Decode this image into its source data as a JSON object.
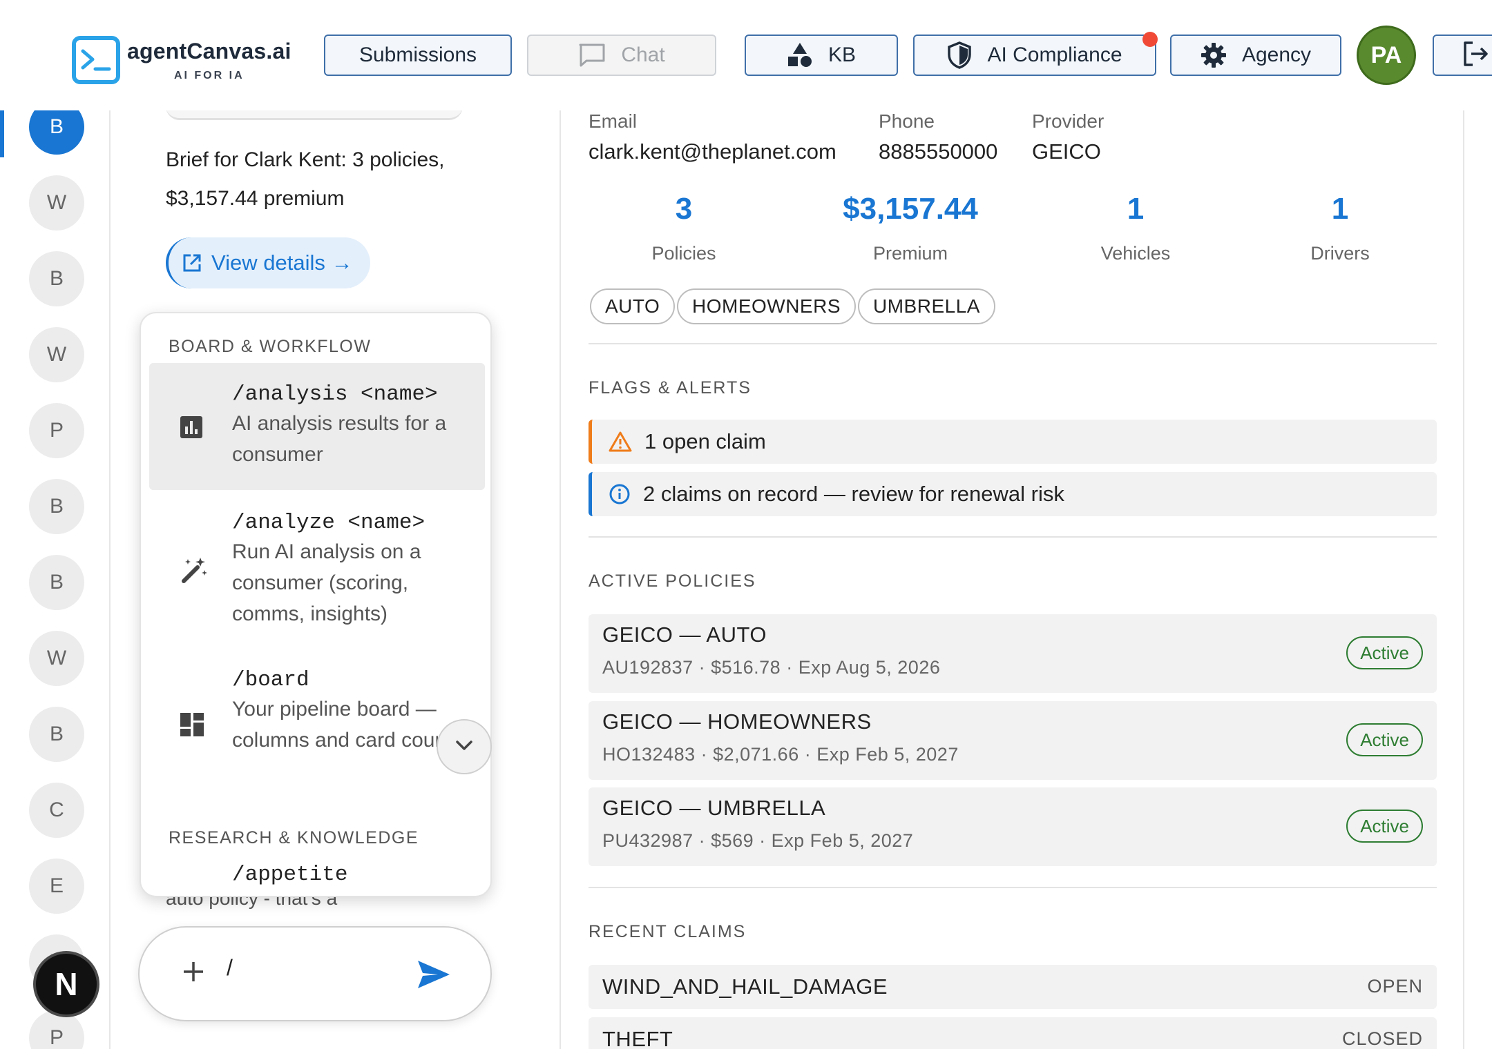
{
  "header": {
    "logo_title": "agentCanvas.ai",
    "logo_sub": "AI FOR IA",
    "nav": {
      "submissions": "Submissions",
      "chat": "Chat",
      "kb": "KB",
      "ai_compliance": "AI Compliance",
      "agency": "Agency"
    },
    "avatar_initials": "PA",
    "colors": {
      "accent": "#1976d2",
      "notification": "#f04a37",
      "avatar": "#5a8a2e"
    }
  },
  "rail": {
    "items": [
      "B",
      "W",
      "B",
      "W",
      "P",
      "B",
      "B",
      "W",
      "B",
      "C",
      "E",
      "B",
      "P"
    ],
    "active_index": 0,
    "next_badge": "N"
  },
  "chat": {
    "brief": "Brief for Clark Kent: 3 policies, $3,157.44 premium",
    "view_details": "View details →",
    "behind_text": "auto policy - that's a",
    "input_value": "/",
    "commands": {
      "section_board": "BOARD & WORKFLOW",
      "section_research": "RESEARCH & KNOWLEDGE",
      "items": [
        {
          "name": "/analysis <name>",
          "desc": "AI analysis results for a consumer",
          "icon": "bar-chart-icon"
        },
        {
          "name": "/analyze <name>",
          "desc": "Run AI analysis on a consumer (scoring, comms, insights)",
          "icon": "magic-wand-icon"
        },
        {
          "name": "/board",
          "desc": "Your pipeline board — columns and card counts",
          "icon": "dashboard-icon"
        },
        {
          "name": "/appetite",
          "desc": "",
          "icon": ""
        }
      ]
    }
  },
  "detail": {
    "email_label": "Email",
    "email": "clark.kent@theplanet.com",
    "phone_label": "Phone",
    "phone": "8885550000",
    "provider_label": "Provider",
    "provider": "GEICO",
    "stats": [
      {
        "value": "3",
        "label": "Policies"
      },
      {
        "value": "$3,157.44",
        "label": "Premium"
      },
      {
        "value": "1",
        "label": "Vehicles"
      },
      {
        "value": "1",
        "label": "Drivers"
      }
    ],
    "chips": [
      "AUTO",
      "HOMEOWNERS",
      "UMBRELLA"
    ],
    "flags_title": "FLAGS & ALERTS",
    "alerts": [
      {
        "text": "1 open claim",
        "level": "warning"
      },
      {
        "text": "2 claims on record — review for renewal risk",
        "level": "info"
      }
    ],
    "policies_title": "ACTIVE POLICIES",
    "policies": [
      {
        "title": "GEICO — AUTO",
        "meta": "AU192837 · $516.78 · Exp Aug 5, 2026",
        "status": "Active"
      },
      {
        "title": "GEICO — HOMEOWNERS",
        "meta": "HO132483 · $2,071.66 · Exp Feb 5, 2027",
        "status": "Active"
      },
      {
        "title": "GEICO — UMBRELLA",
        "meta": "PU432987 · $569 · Exp Feb 5, 2027",
        "status": "Active"
      }
    ],
    "claims_title": "RECENT CLAIMS",
    "claims": [
      {
        "type": "WIND_AND_HAIL_DAMAGE",
        "status": "OPEN"
      },
      {
        "type": "THEFT",
        "status": "CLOSED"
      }
    ]
  }
}
